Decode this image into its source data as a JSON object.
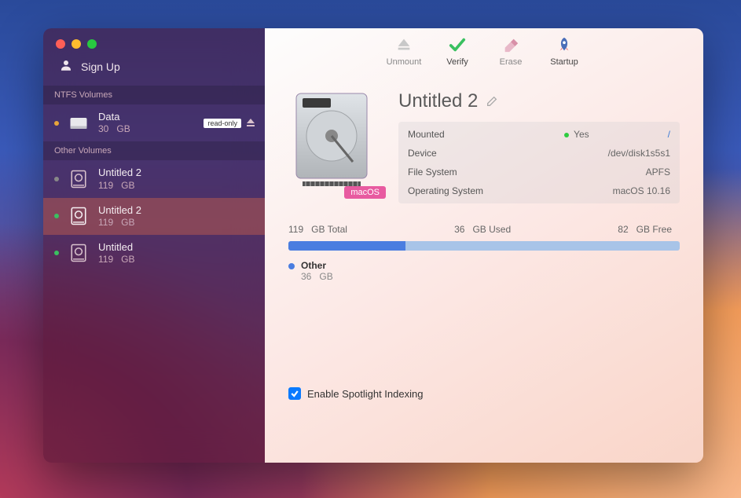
{
  "sidebar": {
    "signup_label": "Sign Up",
    "sections": [
      {
        "header": "NTFS Volumes",
        "items": [
          {
            "name": "Data",
            "size_num": "30",
            "size_unit": "GB",
            "dot": "orange",
            "icon": "external",
            "readonly": "read-only",
            "ejectable": true
          }
        ]
      },
      {
        "header": "Other Volumes",
        "items": [
          {
            "name": "Untitled 2",
            "size_num": "119",
            "size_unit": "GB",
            "dot": "gray",
            "icon": "hdd"
          },
          {
            "name": "Untitled 2",
            "size_num": "119",
            "size_unit": "GB",
            "dot": "green",
            "icon": "hdd",
            "selected": true
          },
          {
            "name": "Untitled",
            "size_num": "119",
            "size_unit": "GB",
            "dot": "green",
            "icon": "hdd"
          }
        ]
      }
    ]
  },
  "toolbar": {
    "unmount": "Unmount",
    "verify": "Verify",
    "erase": "Erase",
    "startup": "Startup"
  },
  "detail": {
    "title": "Untitled 2",
    "os_tag": "macOS",
    "info": {
      "mounted_label": "Mounted",
      "mounted_value": "Yes",
      "mount_point": "/",
      "device_label": "Device",
      "device_value": "/dev/disk1s5s1",
      "fs_label": "File System",
      "fs_value": "APFS",
      "os_label": "Operating System",
      "os_value": "macOS 10.16"
    },
    "usage": {
      "total_num": "119",
      "total_label": "GB Total",
      "used_num": "36",
      "used_label": "GB Used",
      "free_num": "82",
      "free_label": "GB Free",
      "segments": [
        {
          "name": "Other",
          "num": "36",
          "unit": "GB",
          "pct": 30,
          "color": "#4a7de0"
        }
      ]
    },
    "spotlight_label": "Enable Spotlight Indexing",
    "spotlight_checked": true
  }
}
